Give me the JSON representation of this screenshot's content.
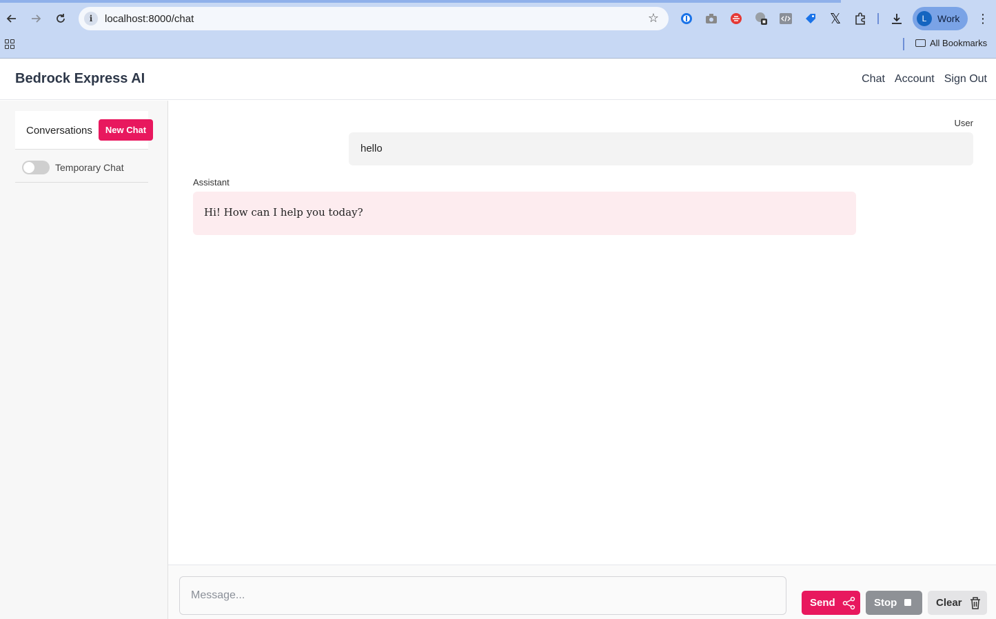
{
  "browser": {
    "url": "localhost:8000/chat",
    "profile_initial": "L",
    "profile_name": "Work",
    "bookmarks_label": "All Bookmarks",
    "icons": [
      "back-icon",
      "forward-icon",
      "reload-icon",
      "site-info-icon",
      "bookmark-star-icon",
      "password-manager-icon",
      "camera-icon",
      "extension-red-icon",
      "extension-globe-icon",
      "code-icon",
      "tag-icon",
      "x-icon",
      "puzzle-icon",
      "download-icon",
      "menu-dots-icon",
      "apps-grid-icon",
      "folder-icon"
    ]
  },
  "app": {
    "brand": "Bedrock Express AI",
    "nav": {
      "chat": "Chat",
      "account": "Account",
      "sign_out": "Sign Out"
    }
  },
  "sidebar": {
    "title": "Conversations",
    "new_chat_label": "New Chat",
    "temporary_chat_label": "Temporary Chat",
    "temporary_chat_enabled": false
  },
  "messages": [
    {
      "role": "User",
      "text": "hello"
    },
    {
      "role": "Assistant",
      "text": "Hi! How can I help you today?"
    }
  ],
  "composer": {
    "placeholder": "Message...",
    "value": "",
    "send_label": "Send",
    "stop_label": "Stop",
    "clear_label": "Clear"
  },
  "colors": {
    "accent": "#e8185e",
    "assistant_bubble": "#fdecef",
    "user_bubble": "#f3f3f3",
    "stop_button": "#8e9196",
    "chrome": "#c7d8f4"
  }
}
